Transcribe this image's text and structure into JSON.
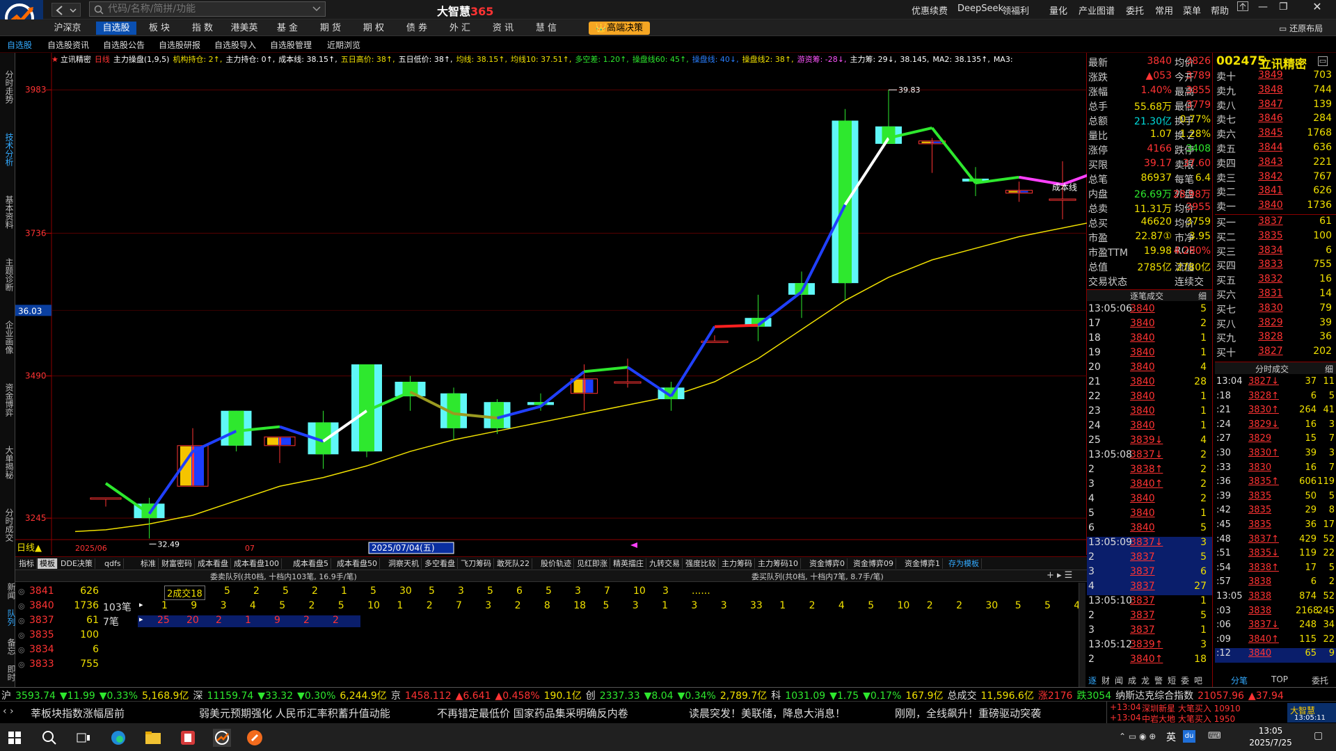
{
  "app": {
    "title": "大智慧",
    "title_suffix": "365",
    "search_placeholder": "代码/名称/简拼/功能",
    "restore_layout": "还原布局",
    "logo_text": "大智慧"
  },
  "window_menu": [
    "优惠续费",
    "DeepSeek",
    "领福利",
    "量化",
    "产业图谱",
    "委托",
    "常用",
    "菜单",
    "帮助"
  ],
  "main_tabs": [
    {
      "label": "沪深京",
      "active": false
    },
    {
      "label": "自选股",
      "active": true
    },
    {
      "label": "板 块",
      "active": false
    },
    {
      "label": "指 数",
      "active": false
    },
    {
      "label": "港美英",
      "active": false
    },
    {
      "label": "基 金",
      "active": false
    },
    {
      "label": "期 货",
      "active": false
    },
    {
      "label": "期 权",
      "active": false
    },
    {
      "label": "债 券",
      "active": false
    },
    {
      "label": "外 汇",
      "active": false
    },
    {
      "label": "资 讯",
      "active": false
    },
    {
      "label": "慧 信",
      "active": false
    }
  ],
  "decision_button": "高端决策",
  "sub_tabs": [
    "自选股",
    "自选股资讯",
    "自选股公告",
    "自选股研报",
    "自选股导入",
    "自选股管理",
    "近期浏览"
  ],
  "side_tabs": [
    "分时走势",
    "技术分析",
    "基本资料",
    "主题诊断",
    "企业画像",
    "资金博弈",
    "大单揭秘",
    "分时成交"
  ],
  "chart": {
    "indicator_line": [
      {
        "t": "立讯精密",
        "c": "#ffffff"
      },
      {
        "t": "日线",
        "c": "#ff3333"
      },
      {
        "t": "主力操盘(1,9,5)",
        "c": "#ffffff"
      },
      {
        "t": "机构持仓: 2↑,",
        "c": "#f0e000"
      },
      {
        "t": "主力持仓: 0↑,",
        "c": "#ffffff"
      },
      {
        "t": "成本线: 38.15↑,",
        "c": "#ffffff"
      },
      {
        "t": "五日高价: 38↑,",
        "c": "#f0e000"
      },
      {
        "t": "五日低价: 38↑,",
        "c": "#ffffff"
      },
      {
        "t": "均线: 38.15↑,",
        "c": "#f0e000"
      },
      {
        "t": "均线10: 37.51↑,",
        "c": "#f0e000"
      },
      {
        "t": "多空差: 1.20↑,",
        "c": "#2ee82e"
      },
      {
        "t": "操盘线60: 45↑,",
        "c": "#2ee82e"
      },
      {
        "t": "操盘线: 40↓,",
        "c": "#2a7fff"
      },
      {
        "t": "操盘线2: 38↑,",
        "c": "#f0e000"
      },
      {
        "t": "游资筹: -28↓,",
        "c": "#ff55ff"
      },
      {
        "t": "主力筹: 29↓,",
        "c": "#ffffff"
      },
      {
        "t": "38.145,",
        "c": "#ffffff"
      },
      {
        "t": "MA2: 38.135↑,",
        "c": "#ffffff"
      },
      {
        "t": "MA3:",
        "c": "#ffffff"
      }
    ],
    "y_labels": [
      "3983",
      "3736",
      "3490",
      "3245"
    ],
    "current_price_tag": "36.03",
    "high_marker": "39.83",
    "low_marker": "32.49",
    "cost_label": "成本线",
    "x_labels": [
      "2025/06",
      "07"
    ],
    "cursor_date": "2025/07/04(五)",
    "period": "日线",
    "chart_data": {
      "type": "candlestick",
      "ylim": [
        32.2,
        40.3
      ],
      "candles": [
        [
          32.8,
          32.8,
          32.65,
          32.8
        ],
        [
          32.7,
          32.8,
          32.1,
          32.45
        ],
        [
          33.0,
          34.0,
          33.0,
          33.7
        ],
        [
          34.3,
          34.3,
          33.6,
          33.7
        ],
        [
          33.7,
          33.85,
          33.4,
          33.85
        ],
        [
          34.1,
          34.3,
          33.3,
          33.55
        ],
        [
          35.1,
          35.1,
          33.5,
          33.6
        ],
        [
          34.8,
          34.9,
          34.3,
          34.55
        ],
        [
          34.6,
          34.7,
          33.8,
          34.0
        ],
        [
          34.45,
          34.5,
          33.9,
          34.0
        ],
        [
          34.45,
          34.6,
          34.3,
          34.4
        ],
        [
          34.6,
          35.1,
          34.3,
          34.85
        ],
        [
          34.8,
          35.2,
          34.7,
          34.8
        ],
        [
          34.7,
          34.8,
          34.3,
          34.5
        ],
        [
          35.5,
          35.6,
          35.5,
          35.5
        ],
        [
          35.9,
          36.3,
          35.5,
          35.75
        ],
        [
          36.5,
          36.7,
          35.9,
          36.3
        ],
        [
          39.3,
          39.5,
          36.2,
          36.5
        ],
        [
          39.2,
          39.83,
          38.9,
          38.9
        ],
        [
          38.9,
          39.0,
          38.4,
          38.95
        ],
        [
          38.3,
          38.5,
          38.0,
          38.25
        ],
        [
          38.05,
          38.25,
          37.9,
          38.1
        ],
        [
          37.95,
          38.6,
          37.6,
          37.95
        ],
        [
          38.0,
          38.7,
          37.9,
          38.45
        ]
      ],
      "cost_line": [
        32.25,
        32.35,
        32.5,
        32.75,
        33.0,
        33.15,
        33.35,
        33.6,
        33.8,
        33.95,
        34.1,
        34.25,
        34.4,
        34.55,
        34.8,
        35.2,
        35.7,
        36.2,
        36.6,
        36.9,
        37.1,
        37.3,
        37.45,
        37.6
      ]
    }
  },
  "indicator_tabs": [
    "指标",
    "模板",
    "DDE决策",
    "qdfs",
    "标准",
    "财富密码",
    "成本看盘",
    "成本看盘100",
    "成本看盘5",
    "成本看盘50",
    "洞察天机",
    "多空看盘",
    "飞刀筹码",
    "敢死队22",
    "股价轨迹",
    "见红即涨",
    "精英擂庄",
    "九转交易",
    "强度比较",
    "主力筹码",
    "主力筹码10",
    "资金博弈0",
    "资金博弈09",
    "资金博弈1",
    "存为模板"
  ],
  "queue": {
    "sell_title": "委卖队列(共0档, 十档内103笔, 16.9手/笔)",
    "buy_title": "委买队列(共0档, 十档内7笔, 8.7手/笔)",
    "side_labels": [
      "新闻",
      "队列",
      "备忘",
      "即时"
    ],
    "rows": [
      {
        "price": "3841",
        "vol": "626",
        "cnt": ""
      },
      {
        "price": "3840",
        "vol": "1736",
        "cnt": "103笔"
      },
      {
        "price": "3837",
        "vol": "61",
        "cnt": "7笔"
      },
      {
        "price": "3835",
        "vol": "100",
        "cnt": ""
      },
      {
        "price": "3834",
        "vol": "6",
        "cnt": ""
      },
      {
        "price": "3833",
        "vol": "755",
        "cnt": ""
      }
    ],
    "deal_hint": "2成交18",
    "row1": [
      "5",
      "2",
      "5",
      "2",
      "1",
      "5",
      "30",
      "5",
      "3",
      "5",
      "6",
      "5",
      "3",
      "7",
      "10",
      "3",
      "......"
    ],
    "row2": [
      "1",
      "9",
      "3",
      "4",
      "5",
      "2",
      "5",
      "10",
      "1",
      "2",
      "7",
      "3",
      "2",
      "8",
      "18",
      "5",
      "3",
      "1",
      "3",
      "3",
      "33",
      "1",
      "2",
      "4",
      "5",
      "10",
      "2",
      "2",
      "30",
      "5",
      "5",
      "4"
    ],
    "row3": [
      "25",
      "20",
      "2",
      "1",
      "9",
      "2",
      "2"
    ]
  },
  "quote": {
    "name": "立讯精密",
    "code": "002475",
    "rows": [
      {
        "l": "最新",
        "v": "3840",
        "vc": "#ff3333",
        "l2": "均价",
        "v2": "3826",
        "v2c": "#ff3333"
      },
      {
        "l": "涨跌",
        "v": "▲053",
        "vc": "#ff3333",
        "l2": "今开",
        "v2": "3789",
        "v2c": "#ff3333"
      },
      {
        "l": "涨幅",
        "v": "1.40%",
        "vc": "#ff3333",
        "l2": "最高",
        "v2": "3855",
        "v2c": "#ff3333"
      },
      {
        "l": "总手",
        "v": "55.68万",
        "vc": "#f0e000",
        "l2": "最低",
        "v2": "3779",
        "v2c": "#ff3333"
      },
      {
        "l": "总额",
        "v": "21.30亿",
        "vc": "#00dcdc",
        "l2": "换手",
        "v2": "0.77%",
        "v2c": "#f0e000"
      },
      {
        "l": "量比",
        "v": "1.07",
        "vc": "#f0e000",
        "l2": "换 Z",
        "v2": "1.28%",
        "v2c": "#f0e000"
      },
      {
        "l": "涨停",
        "v": "4166",
        "vc": "#ff3333",
        "l2": "跌停",
        "v2": "3408",
        "v2c": "#2ee82e"
      },
      {
        "l": "买限",
        "v": "39.17",
        "vc": "#ff3333",
        "l2": "卖限",
        "v2": "37.60",
        "v2c": "#ff3333"
      },
      {
        "l": "总笔",
        "v": "86937",
        "vc": "#f0e000",
        "l2": "每笔",
        "v2": "6.4",
        "v2c": "#f0e000"
      },
      {
        "l": "内盘",
        "v": "26.69万",
        "vc": "#2ee82e",
        "l2": "外盘",
        "v2": "28.98万",
        "v2c": "#ff3333"
      },
      {
        "l": "总卖",
        "v": "11.31万",
        "vc": "#f0e000",
        "l2": "均价",
        "v2": "3955",
        "v2c": "#ff3333"
      },
      {
        "l": "总买",
        "v": "46620",
        "vc": "#f0e000",
        "l2": "均价",
        "v2": "3759",
        "v2c": "#f0e000"
      },
      {
        "l": "市盈",
        "v": "22.87①",
        "vc": "#f0e000",
        "l2": "市净",
        "v2": "3.95",
        "v2c": "#f0e000"
      },
      {
        "l": "市盈TTM",
        "v": "19.98",
        "vc": "#f0e000",
        "l2": "ROE",
        "v2": "4.290%",
        "v2c": "#ff3333"
      },
      {
        "l": "总值",
        "v": "2785亿",
        "vc": "#f0e000",
        "l2": "流值",
        "v2": "2780亿",
        "v2c": "#f0e000"
      },
      {
        "l": "交易状态",
        "v": "",
        "vc": "#ccc",
        "l2": "连续交易",
        "v2": "",
        "v2c": "#ccc"
      }
    ],
    "sells": [
      {
        "l": "卖十",
        "p": "3849",
        "v": "703"
      },
      {
        "l": "卖九",
        "p": "3848",
        "v": "744"
      },
      {
        "l": "卖八",
        "p": "3847",
        "v": "139"
      },
      {
        "l": "卖七",
        "p": "3846",
        "v": "284"
      },
      {
        "l": "卖六",
        "p": "3845",
        "v": "1768"
      },
      {
        "l": "卖五",
        "p": "3844",
        "v": "636"
      },
      {
        "l": "卖四",
        "p": "3843",
        "v": "221"
      },
      {
        "l": "卖三",
        "p": "3842",
        "v": "767"
      },
      {
        "l": "卖二",
        "p": "3841",
        "v": "626"
      },
      {
        "l": "卖一",
        "p": "3840",
        "v": "1736"
      }
    ],
    "buys": [
      {
        "l": "买一",
        "p": "3837",
        "v": "61"
      },
      {
        "l": "买二",
        "p": "3835",
        "v": "100"
      },
      {
        "l": "买三",
        "p": "3834",
        "v": "6"
      },
      {
        "l": "买四",
        "p": "3833",
        "v": "755"
      },
      {
        "l": "买五",
        "p": "3832",
        "v": "16"
      },
      {
        "l": "买六",
        "p": "3831",
        "v": "14"
      },
      {
        "l": "买七",
        "p": "3830",
        "v": "79"
      },
      {
        "l": "买八",
        "p": "3829",
        "v": "39"
      },
      {
        "l": "买九",
        "p": "3828",
        "v": "36"
      },
      {
        "l": "买十",
        "p": "3827",
        "v": "202"
      }
    ],
    "tick_title": "逐笔成交",
    "tick_btn": "细",
    "ticks": [
      {
        "t": "13:05:06",
        "p": "3840",
        "n": "5"
      },
      {
        "t": "17",
        "p": "3840",
        "n": "2"
      },
      {
        "t": "18",
        "p": "3840",
        "n": "1"
      },
      {
        "t": "19",
        "p": "3840",
        "n": "1"
      },
      {
        "t": "20",
        "p": "3840",
        "n": "4"
      },
      {
        "t": "21",
        "p": "3840",
        "n": "28"
      },
      {
        "t": "22",
        "p": "3840",
        "n": "1"
      },
      {
        "t": "23",
        "p": "3840",
        "n": "1"
      },
      {
        "t": "24",
        "p": "3840",
        "n": "1"
      },
      {
        "t": "25",
        "p": "3839↓",
        "n": "4"
      },
      {
        "t": "13:05:08",
        "p": "3837↓",
        "n": "2"
      },
      {
        "t": "2",
        "p": "3838↑",
        "n": "2"
      },
      {
        "t": "3",
        "p": "3840↑",
        "n": "2"
      },
      {
        "t": "4",
        "p": "3840",
        "n": "2"
      },
      {
        "t": "5",
        "p": "3840",
        "n": "1"
      },
      {
        "t": "6",
        "p": "3840",
        "n": "5"
      },
      {
        "t": "13:05:09",
        "p": "3837↓",
        "n": "3"
      },
      {
        "t": "2",
        "p": "3837",
        "n": "5"
      },
      {
        "t": "3",
        "p": "3837",
        "n": "6"
      },
      {
        "t": "4",
        "p": "3837",
        "n": "27"
      },
      {
        "t": "13:05:10",
        "p": "3837",
        "n": "1"
      },
      {
        "t": "2",
        "p": "3837",
        "n": "5"
      },
      {
        "t": "3",
        "p": "3837",
        "n": "1"
      },
      {
        "t": "13:05:12",
        "p": "3839↑",
        "n": "3"
      },
      {
        "t": "2",
        "p": "3840↑",
        "n": "18"
      }
    ],
    "ts_title": "分时成交",
    "ts_btn": "细",
    "ts": [
      {
        "t": "13:04",
        "p": "3827↓",
        "a": "37",
        "b": "11"
      },
      {
        "t": ":18",
        "p": "3828↑",
        "a": "6",
        "b": "5"
      },
      {
        "t": ":21",
        "p": "3830↑",
        "a": "264",
        "b": "41"
      },
      {
        "t": ":24",
        "p": "3829↓",
        "a": "16",
        "b": "3"
      },
      {
        "t": ":27",
        "p": "3829",
        "a": "15",
        "b": "7"
      },
      {
        "t": ":30",
        "p": "3830↑",
        "a": "39",
        "b": "3"
      },
      {
        "t": ":33",
        "p": "3830",
        "a": "16",
        "b": "7"
      },
      {
        "t": ":36",
        "p": "3835↑",
        "a": "606",
        "b": "119"
      },
      {
        "t": ":39",
        "p": "3835",
        "a": "50",
        "b": "5"
      },
      {
        "t": ":42",
        "p": "3835",
        "a": "29",
        "b": "8"
      },
      {
        "t": ":45",
        "p": "3835",
        "a": "36",
        "b": "17"
      },
      {
        "t": ":48",
        "p": "3837↑",
        "a": "429",
        "b": "52"
      },
      {
        "t": ":51",
        "p": "3835↓",
        "a": "119",
        "b": "22"
      },
      {
        "t": ":54",
        "p": "3838↑",
        "a": "17",
        "b": "5"
      },
      {
        "t": ":57",
        "p": "3838",
        "a": "6",
        "b": "2"
      },
      {
        "t": "13:05",
        "p": "3838",
        "a": "874",
        "b": "52"
      },
      {
        "t": ":03",
        "p": "3838",
        "a": "2168",
        "b": "245"
      },
      {
        "t": ":06",
        "p": "3837↓",
        "a": "248",
        "b": "34"
      },
      {
        "t": ":09",
        "p": "3840↑",
        "a": "115",
        "b": "22"
      },
      {
        "t": ":12",
        "p": "3840",
        "a": "65",
        "b": "9"
      }
    ],
    "bottom_tabs_left": [
      "逐",
      "财",
      "闻",
      "成",
      "龙",
      "警",
      "短",
      "委",
      "吧"
    ],
    "bottom_tabs_right": [
      "分笔",
      "TOP",
      "委托"
    ]
  },
  "ticker": [
    {
      "t": "沪",
      "c": "#ddd"
    },
    {
      "t": "3593.74",
      "c": "#2ee82e"
    },
    {
      "t": "▼11.99",
      "c": "#2ee82e"
    },
    {
      "t": "▼0.33%",
      "c": "#2ee82e"
    },
    {
      "t": "5,168.9亿",
      "c": "#f0e000"
    },
    {
      "t": "深",
      "c": "#ddd"
    },
    {
      "t": "11159.74",
      "c": "#2ee82e"
    },
    {
      "t": "▼33.32",
      "c": "#2ee82e"
    },
    {
      "t": "▼0.30%",
      "c": "#2ee82e"
    },
    {
      "t": "6,244.9亿",
      "c": "#f0e000"
    },
    {
      "t": "京",
      "c": "#ddd"
    },
    {
      "t": "1458.112",
      "c": "#ff3333"
    },
    {
      "t": "▲6.641",
      "c": "#ff3333"
    },
    {
      "t": "▲0.458%",
      "c": "#ff3333"
    },
    {
      "t": "190.1亿",
      "c": "#f0e000"
    },
    {
      "t": "创",
      "c": "#ddd"
    },
    {
      "t": "2337.33",
      "c": "#2ee82e"
    },
    {
      "t": "▼8.04",
      "c": "#2ee82e"
    },
    {
      "t": "▼0.34%",
      "c": "#2ee82e"
    },
    {
      "t": "2,789.7亿",
      "c": "#f0e000"
    },
    {
      "t": "科",
      "c": "#ddd"
    },
    {
      "t": "1031.09",
      "c": "#2ee82e"
    },
    {
      "t": "▼1.75",
      "c": "#2ee82e"
    },
    {
      "t": "▼0.17%",
      "c": "#2ee82e"
    },
    {
      "t": "167.9亿",
      "c": "#f0e000"
    },
    {
      "t": "总成交",
      "c": "#ddd"
    },
    {
      "t": "11,596.6亿",
      "c": "#f0e000"
    },
    {
      "t": "涨2176",
      "c": "#ff3333"
    },
    {
      "t": "跌3054",
      "c": "#2ee82e"
    },
    {
      "t": "纳斯达克综合指数",
      "c": "#ddd"
    },
    {
      "t": "21057.96",
      "c": "#ff3333"
    },
    {
      "t": "▲37.94",
      "c": "#ff3333"
    }
  ],
  "news": [
    "莘板块指数涨幅居前",
    "弱美元预期强化 人民币汇率积蓄升值动能",
    "不再错定最低价 国家药品集采明确反内卷",
    "读晨突发！美联储，降息大消息！",
    "刚刚，全线飙升！重磅驱动突袭"
  ],
  "alerts": [
    {
      "t": "13:04",
      "txt": "深圳新星 大笔买入 10910"
    },
    {
      "t": "13:04",
      "txt": "中岩大地 大笔买入 1950"
    }
  ],
  "taskbar": {
    "time": "13:05",
    "date": "2025/7/25",
    "ime": "英",
    "clock": "13:05:11"
  }
}
